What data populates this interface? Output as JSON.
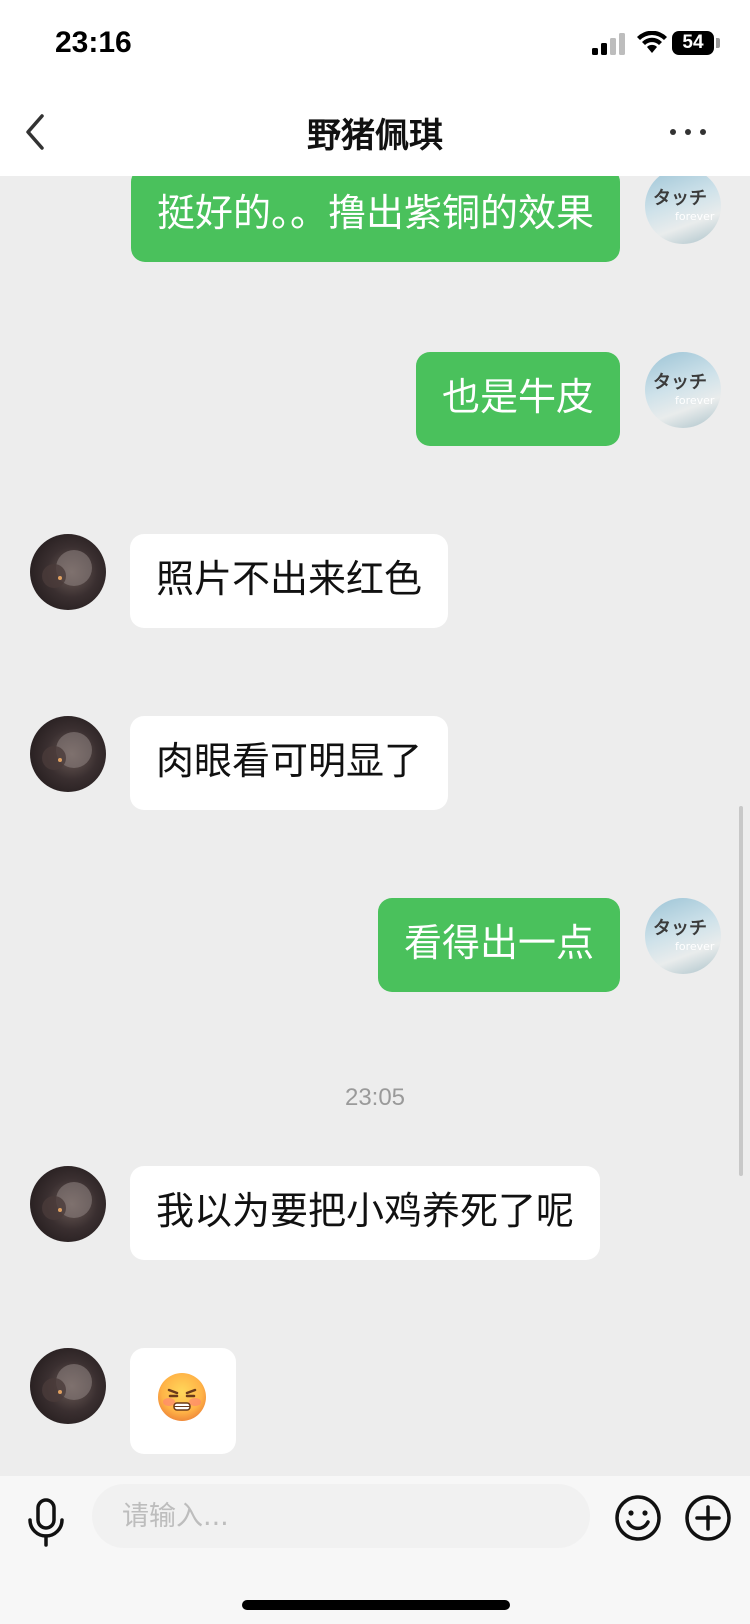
{
  "status_bar": {
    "time": "23:16",
    "battery": "54"
  },
  "header": {
    "title": "野猪佩琪"
  },
  "messages": [
    {
      "sender": "me",
      "text": "挺好的。。撸出紫铜的效果"
    },
    {
      "sender": "me",
      "text": "也是牛皮"
    },
    {
      "sender": "other",
      "text": "照片不出来红色"
    },
    {
      "sender": "other",
      "text": "肉眼看可明显了"
    },
    {
      "sender": "me",
      "text": "看得出一点"
    },
    {
      "timestamp": "23:05"
    },
    {
      "sender": "other",
      "text": "我以为要把小鸡养死了呢"
    },
    {
      "sender": "other",
      "type": "emoji",
      "emoji": "grinning-steam-face"
    }
  ],
  "input": {
    "placeholder": "请输入..."
  },
  "icons": {
    "back": "chevron-left-icon",
    "more": "more-dots-icon",
    "voice": "microphone-icon",
    "emoji": "smile-icon",
    "add": "plus-circle-icon"
  },
  "colors": {
    "my_bubble": "#4ac15c",
    "other_bubble": "#ffffff",
    "background": "#ededed"
  }
}
